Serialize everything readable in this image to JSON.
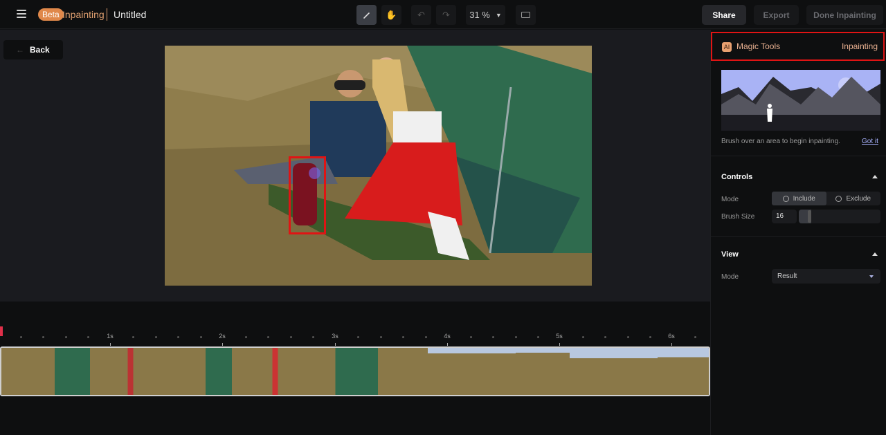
{
  "header": {
    "badge": "Beta",
    "mode": "Inpainting",
    "title": "Untitled",
    "zoom": "31 %",
    "share": "Share",
    "export": "Export",
    "done": "Done Inpainting"
  },
  "toolbar": {
    "tools": [
      "brush-icon",
      "hand-icon",
      "undo-icon",
      "redo-icon",
      "keyboard-icon"
    ]
  },
  "canvas": {
    "back": "Back"
  },
  "timeline": {
    "ticks": [
      "1s",
      "2s",
      "3s",
      "4s",
      "5s",
      "6s"
    ]
  },
  "panel": {
    "magic_tools": "Magic Tools",
    "ai_badge": "AI",
    "active_tool": "Inpainting",
    "hint": "Brush over an area to begin inpainting.",
    "got_it": "Got it",
    "controls": {
      "title": "Controls",
      "mode_label": "Mode",
      "include": "Include",
      "exclude": "Exclude",
      "selected_mode": "Include",
      "brush_label": "Brush Size",
      "brush_value": "16",
      "brush_fraction": 0.1
    },
    "view": {
      "title": "View",
      "mode_label": "Mode",
      "mode_value": "Result"
    }
  }
}
